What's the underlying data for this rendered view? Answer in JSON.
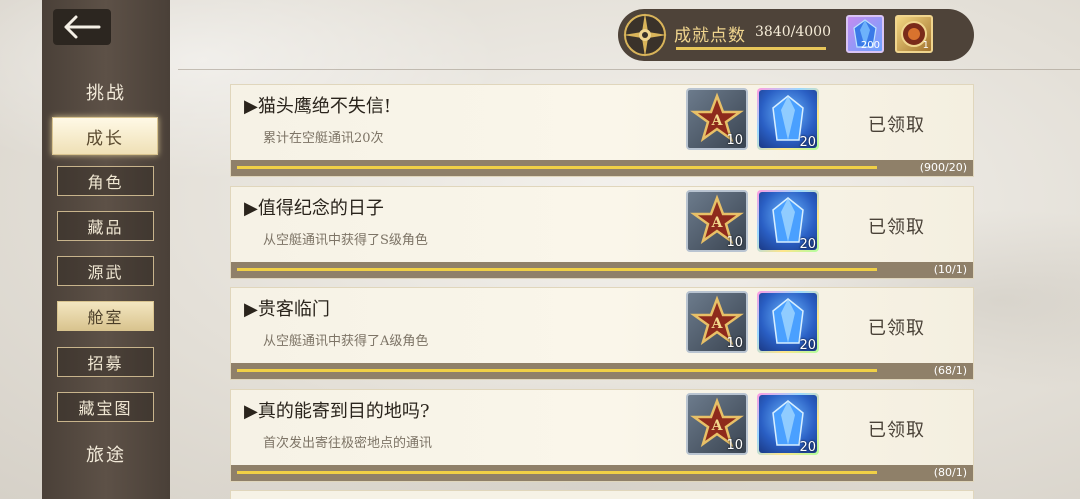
{
  "sidebar": {
    "back_icon": "arrow-left-icon",
    "section_challenge": "挑战",
    "section_growth": "成长",
    "items": [
      {
        "label": "角色"
      },
      {
        "label": "藏品"
      },
      {
        "label": "源武"
      },
      {
        "label": "舱室"
      },
      {
        "label": "招募"
      },
      {
        "label": "藏宝图"
      }
    ],
    "selected_item": "舱室",
    "section_journey": "旅途"
  },
  "header": {
    "points_label": "成就点数",
    "points_value": "3840/4000",
    "points_progress": 0.96,
    "rewards": [
      {
        "icon": "crystal-icon",
        "count": "200"
      },
      {
        "icon": "badge-icon",
        "count": "1"
      }
    ]
  },
  "achievements": [
    {
      "title": "▶猫头鹰绝不失信!",
      "description": "累计在空艇通讯20次",
      "rewards": [
        {
          "icon": "a-rank-star-icon",
          "count": "10"
        },
        {
          "icon": "crystal-icon",
          "count": "20"
        }
      ],
      "status": "已领取",
      "progress_text": "(900/20)",
      "progress": 1.0
    },
    {
      "title": "▶值得纪念的日子",
      "description": "从空艇通讯中获得了S级角色",
      "rewards": [
        {
          "icon": "a-rank-star-icon",
          "count": "10"
        },
        {
          "icon": "crystal-icon",
          "count": "20"
        }
      ],
      "status": "已领取",
      "progress_text": "(10/1)",
      "progress": 1.0
    },
    {
      "title": "▶贵客临门",
      "description": "从空艇通讯中获得了A级角色",
      "rewards": [
        {
          "icon": "a-rank-star-icon",
          "count": "10"
        },
        {
          "icon": "crystal-icon",
          "count": "20"
        }
      ],
      "status": "已领取",
      "progress_text": "(68/1)",
      "progress": 1.0
    },
    {
      "title": "▶真的能寄到目的地吗?",
      "description": "首次发出寄往极密地点的通讯",
      "rewards": [
        {
          "icon": "a-rank-star-icon",
          "count": "10"
        },
        {
          "icon": "crystal-icon",
          "count": "20"
        }
      ],
      "status": "已领取",
      "progress_text": "(80/1)",
      "progress": 1.0
    }
  ],
  "colors": {
    "accent_gold": "#f0d046",
    "panel_dark": "#4e4339",
    "card_bg": "#f6f2e6"
  }
}
